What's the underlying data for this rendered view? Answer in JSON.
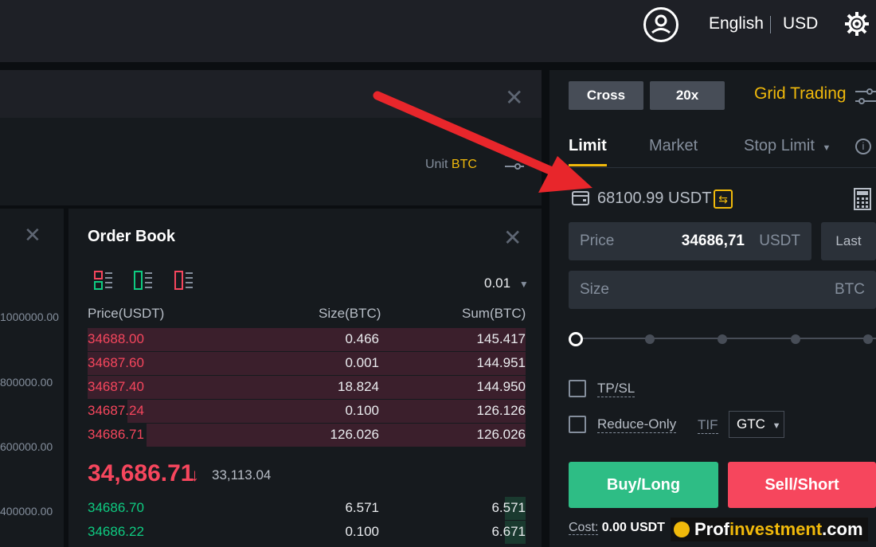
{
  "header": {
    "language": "English",
    "currency": "USD"
  },
  "chart_panel": {
    "unit_label": "Unit",
    "unit_value": "BTC"
  },
  "depth_axis": [
    "1000000.00",
    "800000.00",
    "600000.00",
    "400000.00"
  ],
  "order_book": {
    "title": "Order Book",
    "precision": "0.01",
    "headers": [
      "Price(USDT)",
      "Size(BTC)",
      "Sum(BTC)"
    ],
    "asks": [
      {
        "price": "34688.00",
        "size": "0.466",
        "sum": "145.417"
      },
      {
        "price": "34687.60",
        "size": "0.001",
        "sum": "144.951"
      },
      {
        "price": "34687.40",
        "size": "18.824",
        "sum": "144.950"
      },
      {
        "price": "34687.24",
        "size": "0.100",
        "sum": "126.126"
      },
      {
        "price": "34686.71",
        "size": "126.026",
        "sum": "126.026"
      }
    ],
    "last_price": "34,686.71",
    "mark_price": "33,113.04",
    "bids": [
      {
        "price": "34686.70",
        "size": "6.571",
        "sum": "6.571"
      },
      {
        "price": "34686.22",
        "size": "0.100",
        "sum": "6.671"
      }
    ]
  },
  "order_form": {
    "margin_mode": "Cross",
    "leverage": "20x",
    "grid_trading": "Grid Trading",
    "tabs": [
      "Limit",
      "Market",
      "Stop Limit"
    ],
    "balance": "68100.99 USDT",
    "price_label": "Price",
    "price_value": "34686,71",
    "price_unit": "USDT",
    "last_button": "Last",
    "size_label": "Size",
    "size_unit": "BTC",
    "tpsl_label": "TP/SL",
    "reduce_only_label": "Reduce-Only",
    "tif_label": "TIF",
    "tif_value": "GTC",
    "buy_label": "Buy/Long",
    "sell_label": "Sell/Short",
    "cost_label": "Cost:",
    "cost_value": "0.00 USDT"
  },
  "watermark": {
    "part1": "Prof",
    "part2": "investment",
    "part3": ".com"
  },
  "colors": {
    "accent": "#f0b90b",
    "sell": "#f6465d",
    "buy": "#2ebd85"
  }
}
